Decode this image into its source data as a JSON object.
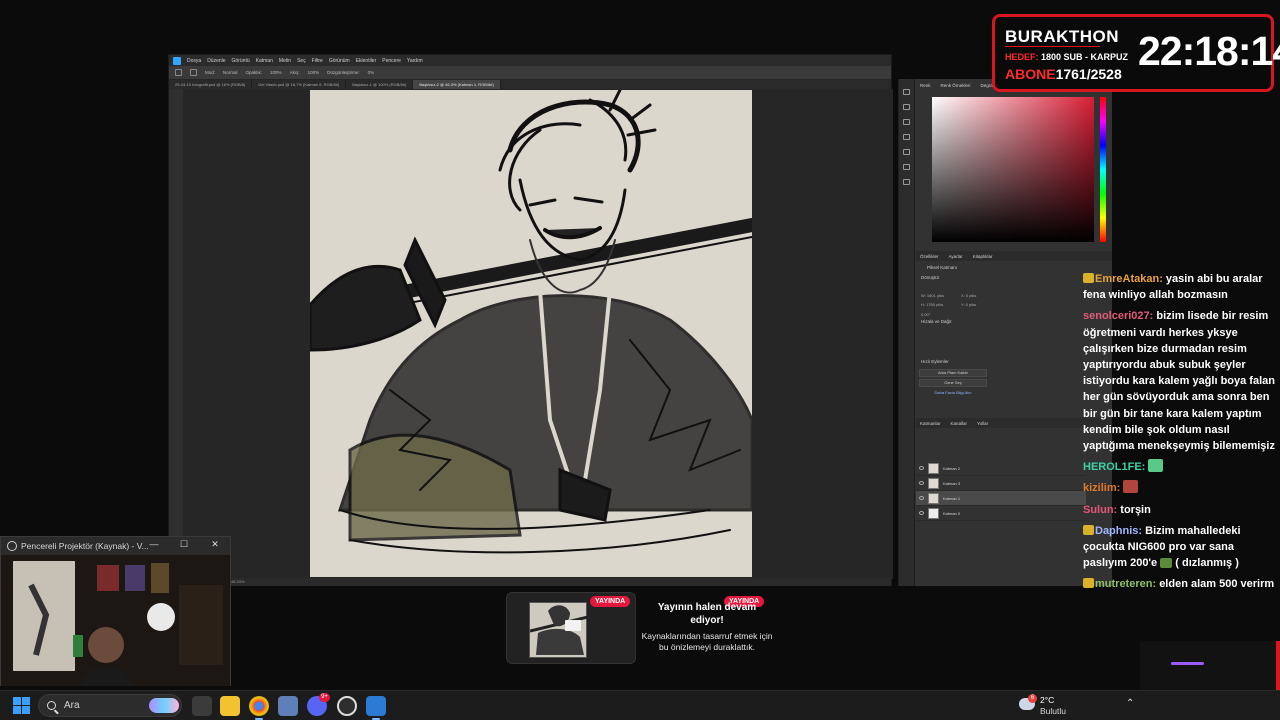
{
  "photoshop": {
    "menu": [
      "Dosya",
      "Düzenle",
      "Görüntü",
      "Katman",
      "Metin",
      "Seç",
      "Filtre",
      "Görünüm",
      "Eklentiler",
      "Pencere",
      "Yardım"
    ],
    "options": {
      "mode_label": "Mod:",
      "mode_value": "Normal",
      "opacity_label": "Opaklık:",
      "opacity_value": "100%",
      "flow_label": "Akış:",
      "flow_value": "100%",
      "smoothing_label": "Düzgünleştirme:",
      "smoothing_value": "0%"
    },
    "tabs": [
      "25-04-10 fotografit.psd @ 16% (RGB/8)",
      "Del Vitado.psd @ 16,7% (Katman 6, RGB/8#)",
      "Başlıksız-1 @ 100% (RGB/8#)",
      "Başlıksız-2 @ 46,3% (Katman 1, RGB/8#)"
    ],
    "active_tab_index": 3,
    "status_text": "46,33%",
    "right_panel": {
      "color_tabs": [
        "Renk",
        "Renk Örnekleri",
        "Degradeler",
        "Desenler"
      ],
      "properties_tabs": [
        "Özellikler",
        "Ayarlar",
        "Kitaplıklar"
      ],
      "properties_title": "Piksel Katmanı",
      "transform_label": "Dönüştür",
      "fields": {
        "w": "W: 1601 piks",
        "h": "H: 1760 piks",
        "x": "X: 0 piks",
        "y": "Y: 0 piks",
        "angle": "0,00°"
      },
      "align_title": "Hizala ve Dağıt",
      "quick_actions_title": "Hızlı Eylemler",
      "quick_actions": [
        "Arka Planı Kaldır",
        "Özne Seç",
        "Daha Fazla Bilgi Alın"
      ],
      "layers_tabs": [
        "Katmanlar",
        "Kanallar",
        "Yollar"
      ],
      "layers": [
        {
          "name": "Katman 2",
          "active": false
        },
        {
          "name": "Katman 3",
          "active": false
        },
        {
          "name": "Katman 1",
          "active": true
        },
        {
          "name": "Katman 0",
          "active": false
        }
      ]
    }
  },
  "burakthon": {
    "title": "BURAKTHON",
    "goal_label": "HEDEF:",
    "goal_value": "1800 SUB - KARPUZ",
    "sub_label": "ABONE",
    "sub_value": "1761/2528",
    "timer": "22:18:14",
    "accent_color": "#d8161f"
  },
  "chat": [
    {
      "user": "EmreAtakan:",
      "color": "#e8a23a",
      "badge": true,
      "text": "yasin abi bu aralar fena winliyo allah bozmasın"
    },
    {
      "user": "senolceri027:",
      "color": "#e05c7a",
      "badge": false,
      "text": "bizim lisede bir resim öğretmeni vardı herkes yksye çalışırken bize durmadan resim yaptırıyordu abuk subuk şeyler istiyordu kara kalem yağlı boya falan her gün sövüyorduk ama sonra ben bir gün bir tane kara kalem yaptım kendim bile şok oldum nasıl yaptığıma menekşeymiş bilememişiz"
    },
    {
      "user": "HEROL1FE:",
      "color": "#3fd0a6",
      "badge": false,
      "text": "",
      "emote": "#59c98a"
    },
    {
      "user": "kizilim:",
      "color": "#e07a2a",
      "badge": false,
      "text": "",
      "emote": "#b1443c"
    },
    {
      "user": "Sulun:",
      "color": "#e8557a",
      "badge": false,
      "text": "torşin"
    },
    {
      "user": "Daphnis:",
      "color": "#9fb7ff",
      "badge": true,
      "text": "Bizim mahalledeki çocukta NIG600 pro var sana paslıyım 200'e",
      "tail": "( dızlanmış )"
    },
    {
      "user": "mutreteren:",
      "color": "#8fbf6a",
      "badge": true,
      "text": "elden alam 500 verirm"
    }
  ],
  "projector": {
    "title": "Pencereli Projektör (Kaynak) - V...",
    "minimize": "—",
    "maximize": "☐",
    "close": "✕"
  },
  "stream_paused": {
    "badge": "YAYINDA",
    "title": "Yayının halen devam ediyor!",
    "subtitle": "Kaynaklarından tasarruf etmek için bu önizlemeyi duraklattık."
  },
  "taskbar": {
    "search_placeholder": "Ara",
    "apps": [
      "file-explorer-icon",
      "chrome-icon",
      "teams-icon",
      "discord-icon",
      "obs-icon",
      "photoshop-icon"
    ],
    "weather_temp": "2°C",
    "weather_desc": "Bulutlu",
    "weather_badge": "6",
    "discord_badge": "9+"
  }
}
